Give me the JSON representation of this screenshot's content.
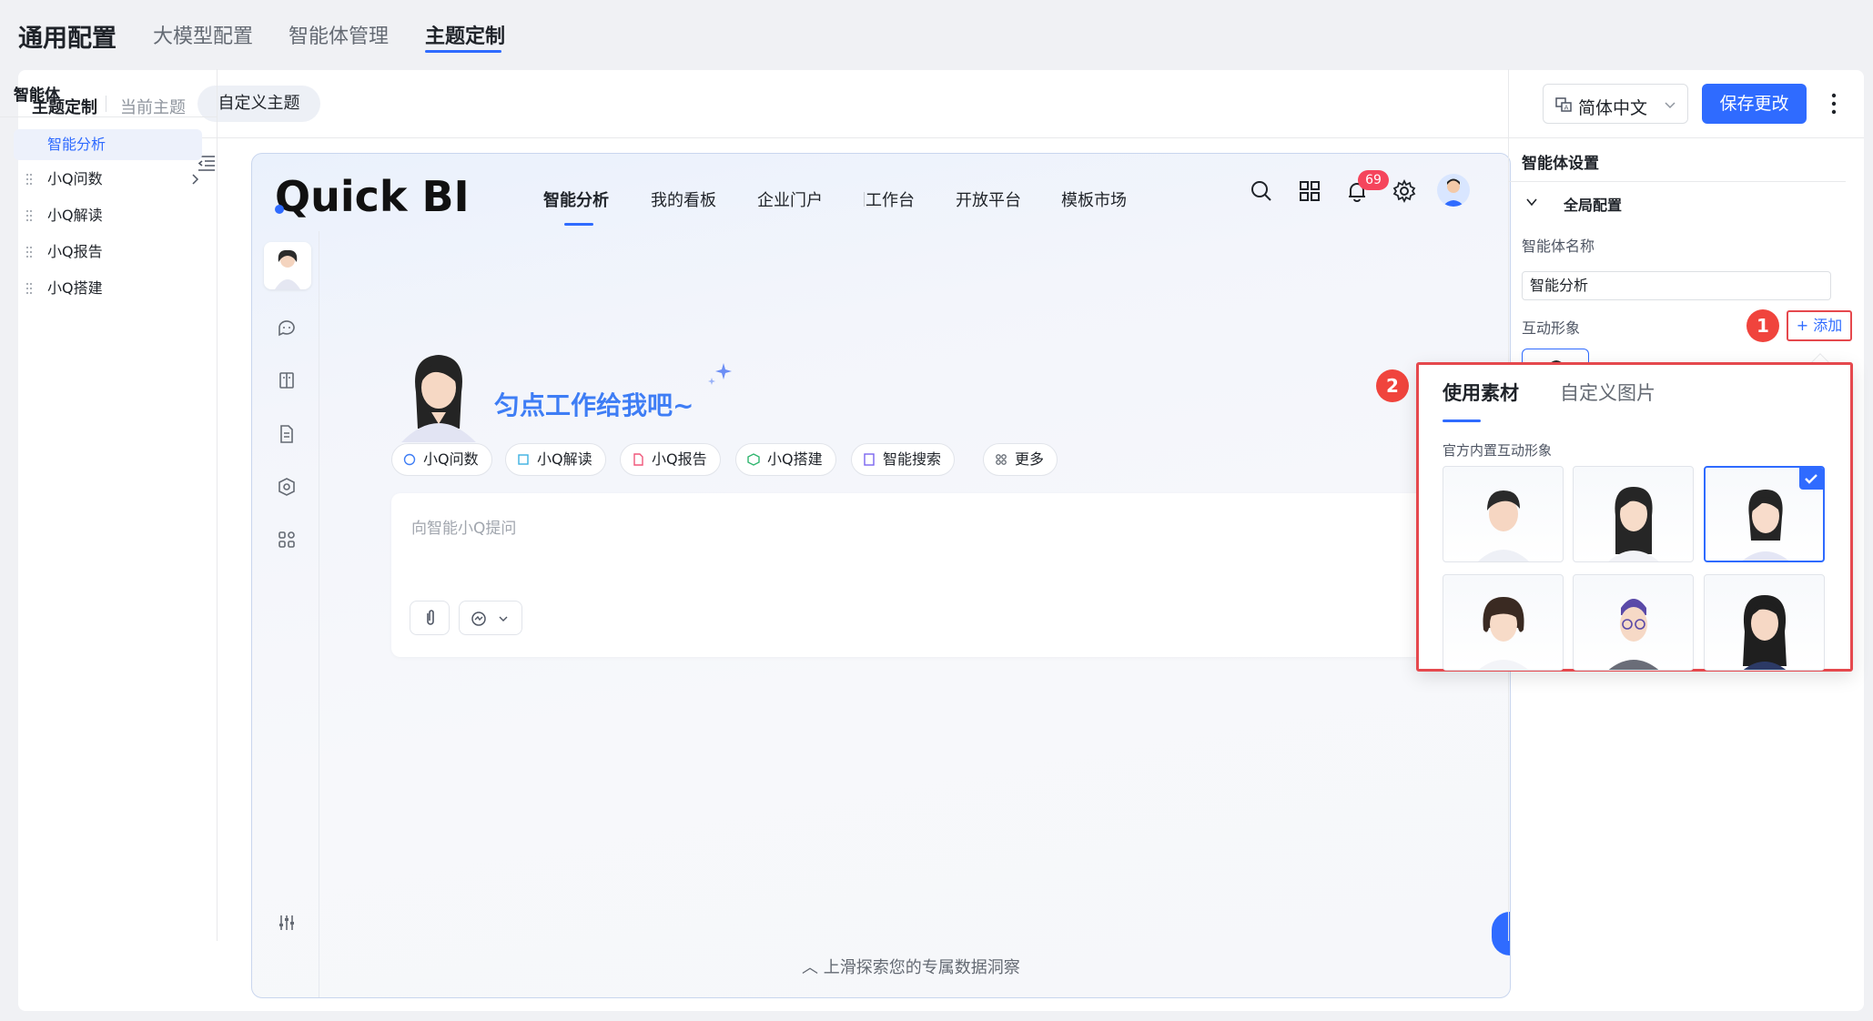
{
  "top_tabs": [
    {
      "label": "通用配置"
    },
    {
      "label": "大模型配置"
    },
    {
      "label": "智能体管理"
    },
    {
      "label": "主题定制"
    }
  ],
  "theme_bar": {
    "title": "主题定制",
    "current_label": "当前主题",
    "custom_label": "自定义主题",
    "language": "简体中文",
    "save_label": "保存更改"
  },
  "left_panel": {
    "title": "智能体",
    "root": "智能分析",
    "items": [
      {
        "label": "小Q问数"
      },
      {
        "label": "小Q解读"
      },
      {
        "label": "小Q报告"
      },
      {
        "label": "小Q搭建"
      }
    ]
  },
  "preview": {
    "logo": "Quick BI",
    "nav": [
      {
        "label": "智能分析"
      },
      {
        "label": "我的看板"
      },
      {
        "label": "企业门户"
      },
      {
        "label": "工作台"
      },
      {
        "label": "开放平台"
      },
      {
        "label": "模板市场"
      }
    ],
    "notification_count": "69",
    "hero_text": "匀点工作给我吧~",
    "chips": [
      {
        "label": "小Q问数",
        "color": "#3e7df5"
      },
      {
        "label": "小Q解读",
        "color": "#3cb0e0"
      },
      {
        "label": "小Q报告",
        "color": "#f0577a"
      },
      {
        "label": "小Q搭建",
        "color": "#2fb56e"
      },
      {
        "label": "智能搜索",
        "color": "#7a65f0"
      },
      {
        "label": "更多",
        "color": "#646a73"
      }
    ],
    "input_placeholder": "向智能小Q提问",
    "scroll_hint": "︿ 上滑探索您的专属数据洞察"
  },
  "right_panel": {
    "title": "智能体设置",
    "section": "全局配置",
    "name_label": "智能体名称",
    "name_value": "智能分析",
    "avatar_label": "互动形象",
    "add_label": "+ 添加"
  },
  "steps": [
    "1",
    "2"
  ],
  "popover": {
    "tabs": [
      {
        "label": "使用素材"
      },
      {
        "label": "自定义图片"
      }
    ],
    "subtitle": "官方内置互动形象",
    "avatars": [
      {
        "id": "male-young",
        "selected": false
      },
      {
        "id": "female-long-hair",
        "selected": false
      },
      {
        "id": "female-ponytail",
        "selected": true
      },
      {
        "id": "female-bob",
        "selected": false
      },
      {
        "id": "female-glasses",
        "selected": false
      },
      {
        "id": "female-wavy",
        "selected": false
      }
    ]
  },
  "colors": {
    "accent": "#2f6bff",
    "highlight_red": "#e5484d",
    "badge_red": "#f5455c"
  }
}
